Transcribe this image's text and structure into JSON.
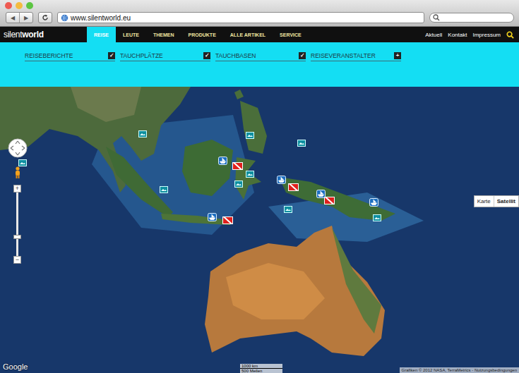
{
  "browser": {
    "back": "◀",
    "forward": "▶",
    "url": "www.silentworld.eu"
  },
  "nav": {
    "logo": {
      "light": "silent",
      "bold": "world"
    },
    "tabs": [
      {
        "label": "REISE",
        "selected": true
      },
      {
        "label": "LEUTE",
        "selected": false
      },
      {
        "label": "THEMEN",
        "selected": false
      },
      {
        "label": "PRODUKTE",
        "selected": false
      },
      {
        "label": "ALLE  ARTIKEL",
        "selected": false
      },
      {
        "label": "SERVICE",
        "selected": false
      }
    ],
    "links": [
      "Aktuell",
      "Kontakt",
      "Impressum"
    ]
  },
  "filters": {
    "marks": {
      "on": "✓",
      "off": "+"
    },
    "items": [
      {
        "label": "REISEBERICHTE",
        "checked": true
      },
      {
        "label": "TAUCHPLÄTZE",
        "checked": true
      },
      {
        "label": "TAUCHBASEN",
        "checked": true
      },
      {
        "label": "REISEVERANSTALTER",
        "checked": false
      }
    ]
  },
  "map": {
    "type_buttons": [
      {
        "label": "Karte",
        "selected": false
      },
      {
        "label": "Satellit",
        "selected": true
      }
    ],
    "zoom_in": "+",
    "zoom_out": "−",
    "brand": "Google",
    "scale": {
      "metric": "1000 km",
      "imperial": "500 Meilen"
    },
    "attribution": "Grafiken © 2012 NASA, TerraMetrics - Nutzungsbedingungen",
    "pins": [
      {
        "kind": "photo"
      },
      {
        "kind": "photo"
      },
      {
        "kind": "photo"
      },
      {
        "kind": "photo"
      },
      {
        "kind": "photo"
      },
      {
        "kind": "photo"
      },
      {
        "kind": "photo"
      },
      {
        "kind": "photo"
      },
      {
        "kind": "photo"
      },
      {
        "kind": "base"
      },
      {
        "kind": "base"
      },
      {
        "kind": "base"
      },
      {
        "kind": "base"
      },
      {
        "kind": "base"
      },
      {
        "kind": "flag"
      },
      {
        "kind": "flag"
      },
      {
        "kind": "flag"
      },
      {
        "kind": "flag"
      }
    ]
  }
}
